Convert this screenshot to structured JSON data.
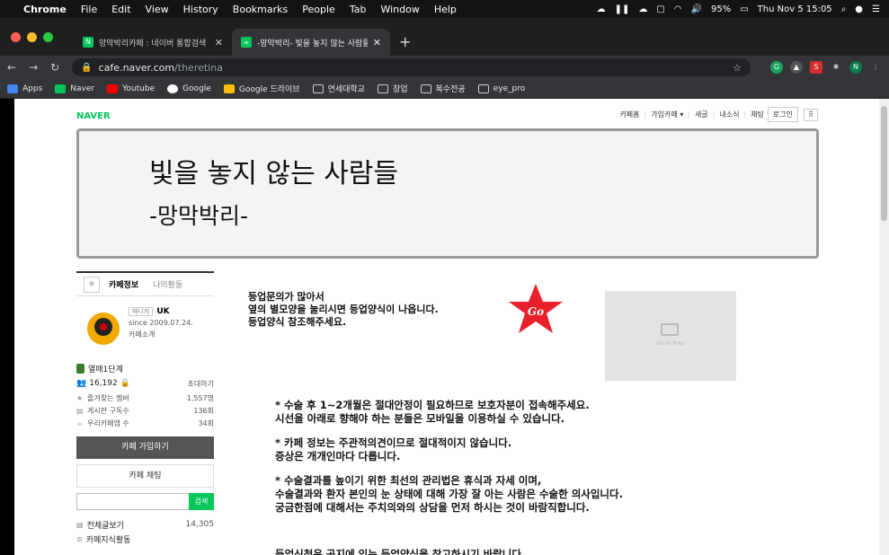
{
  "menubar": {
    "app_name": "Chrome",
    "menus": [
      "File",
      "Edit",
      "View",
      "History",
      "Bookmarks",
      "People",
      "Tab",
      "Window",
      "Help"
    ],
    "battery": "95%",
    "clock": "Thu Nov 5  15:05"
  },
  "tabs": [
    {
      "title": "망막박리카페 : 네이버 통합검색",
      "favicon": "N"
    },
    {
      "title": "-망막박리- 빛을 놓지 않는 사람들의",
      "favicon": "☕"
    }
  ],
  "omnibox": {
    "host": "cafe.naver.com",
    "path": "/theretina"
  },
  "bookmarks": [
    "Apps",
    "Naver",
    "Youtube",
    "Google",
    "Google 드라이브",
    "연세대학교",
    "창업",
    "복수전공",
    "eye_pro"
  ],
  "gnb": {
    "logo": "NAVER",
    "links": [
      "카페홈",
      "가입카페 ▾",
      "새글",
      "내소식",
      "채팅"
    ],
    "login": "로그인"
  },
  "banner": {
    "title": "빛을 놓지 않는 사람들",
    "subtitle": "-망막박리-"
  },
  "sidebar": {
    "tab_info": "카페정보",
    "tab_activity": "나의활동",
    "manager_label": "매니저",
    "manager_name": "UK",
    "since": "since 2009.07.24.",
    "intro": "카페소개",
    "level": "열매1단계",
    "members": "16,192",
    "invite": "초대하기",
    "stats": [
      {
        "label": "즐겨찾는 멤버",
        "value": "1,557명"
      },
      {
        "label": "게시판 구독수",
        "value": "136회"
      },
      {
        "label": "우리카페앱 수",
        "value": "34회"
      }
    ],
    "join_button": "카페 가입하기",
    "chat_button": "카페 채팅",
    "search_button": "검색",
    "menu": [
      {
        "label": "전체글보기",
        "value": "14,305"
      },
      {
        "label": "카페지식활동",
        "value": ""
      }
    ]
  },
  "content": {
    "notice_lines": [
      "등업문의가 많아서",
      "옆의 별모양을 눌리시면 등업양식이 나옵니다.",
      "등업양식 참조해주세요."
    ],
    "go_label": "Go",
    "nopic_label": "NO PICTURE",
    "paragraphs": [
      [
        "* 수술 후 1~2개월은 절대안정이 필요하므로 보호자분이 접속해주세요.",
        "시선을 아래로 향해야 하는 분들은 모바일을 이용하실 수 있습니다."
      ],
      [
        "* 카페 정보는 주관적의견이므로 절대적이지 않습니다.",
        "증상은 개개인마다 다릅니다."
      ],
      [
        "* 수술결과를 높이기 위한 최선의 관리법은 휴식과 자세 이며,",
        "수술결과와 환자 본인의 눈 상태에 대해 가장 잘 아는 사람은 수술한 의사입니다.",
        "궁금한점에 대해서는 주치의와의 상담을 먼저 하시는 것이 바람직합니다."
      ]
    ],
    "cut_line": "등업신청은 공지에 있는 등업양식을 참고하시기 바랍니다."
  }
}
